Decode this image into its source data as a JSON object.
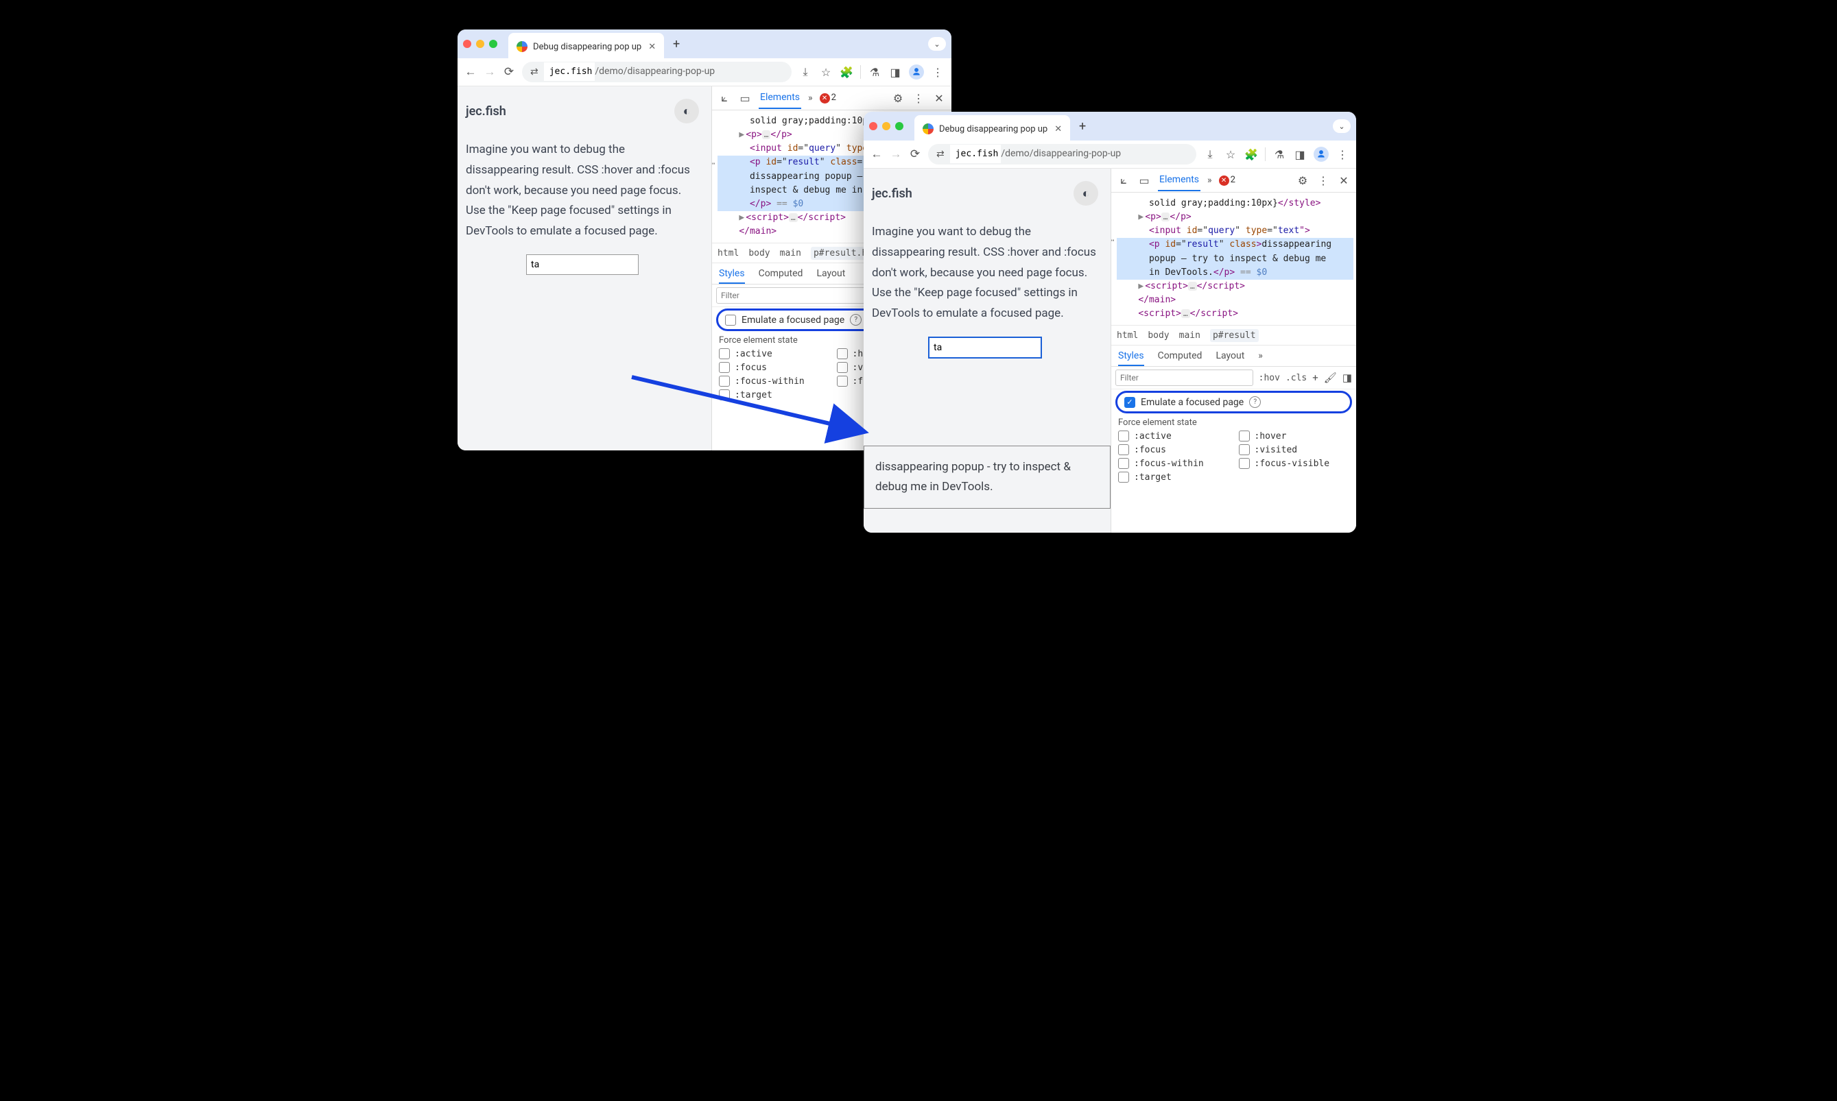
{
  "tab": {
    "title": "Debug disappearing pop up"
  },
  "url": {
    "scheme_icon": "⇄",
    "domain": "jec.fish",
    "path": "/demo/disappearing-pop-up"
  },
  "page": {
    "site": "jec.fish",
    "paragraph": "Imagine you want to debug the dissappearing result. CSS :hover and :focus don't work, because you need page focus. Use the \"Keep page focused\" settings in DevTools to emulate a focused page.",
    "input_value": "ta",
    "popup_text": "dissappearing popup - try to inspect & debug me in DevTools."
  },
  "devtools": {
    "tab_elements": "Elements",
    "more": "»",
    "error_count": "2",
    "breadcrumbs_left": [
      "html",
      "body",
      "main",
      "p#result.hid"
    ],
    "breadcrumbs_right": [
      "html",
      "body",
      "main",
      "p#result"
    ],
    "subtabs": {
      "styles": "Styles",
      "computed": "Computed",
      "layout": "Layout",
      "more": "»"
    },
    "filter_placeholder": "Filter",
    "hov": ":hov",
    "cls": ".cls",
    "emulate_label": "Emulate a focused page",
    "force_label": "Force element state",
    "states": [
      ":active",
      ":hover",
      ":focus",
      ":visited",
      ":focus-within",
      ":focus-visible",
      ":target"
    ],
    "dom_left": {
      "l0": "solid gray;padding:10p",
      "l1a": "▶",
      "l1b": "<p>",
      "l1c": "…",
      "l1d": "</p>",
      "l2a": "<input ",
      "l2b": "id",
      "l2c": "=\"",
      "l2d": "query",
      "l2e": "\" ",
      "l2f": "type",
      "l3a": "<p ",
      "l3b": "id",
      "l3c": "=\"",
      "l3d": "result",
      "l3e": "\" ",
      "l3f": "class",
      "l3g": "=\"",
      "l4": "dissappearing popup – ",
      "l5": "inspect & debug me in ",
      "l6a": "</p>",
      "l6b": " == ",
      "l6c": "$0",
      "l7a": "▶",
      "l7b": "<script>",
      "l7c": "…",
      "l7d": "</script>",
      "l8": "</main>"
    },
    "dom_right": {
      "r0a": "solid gray;padding:10px}",
      "r0b": "</style>",
      "r1a": "▶",
      "r1b": "<p>",
      "r1c": "…",
      "r1d": "</p>",
      "r2a": "<input ",
      "r2b": "id",
      "r2c": "=\"",
      "r2d": "query",
      "r2e": "\" ",
      "r2f": "type",
      "r2g": "=\"",
      "r2h": "text",
      "r2i": "\">",
      "r3a": "<p ",
      "r3b": "id",
      "r3c": "=\"",
      "r3d": "result",
      "r3e": "\" ",
      "r3f": "class",
      "r3g": ">",
      "r4": "dissappearing popup – try to inspect & debug me in DevTools.",
      "r5a": "</p>",
      "r5b": " == ",
      "r5c": "$0",
      "r6a": "▶",
      "r6b": "<script>",
      "r6c": "…",
      "r6d": "</script>",
      "r7": "</main>",
      "r8a": "<script>",
      "r8b": "…",
      "r8c": "</script>"
    }
  }
}
